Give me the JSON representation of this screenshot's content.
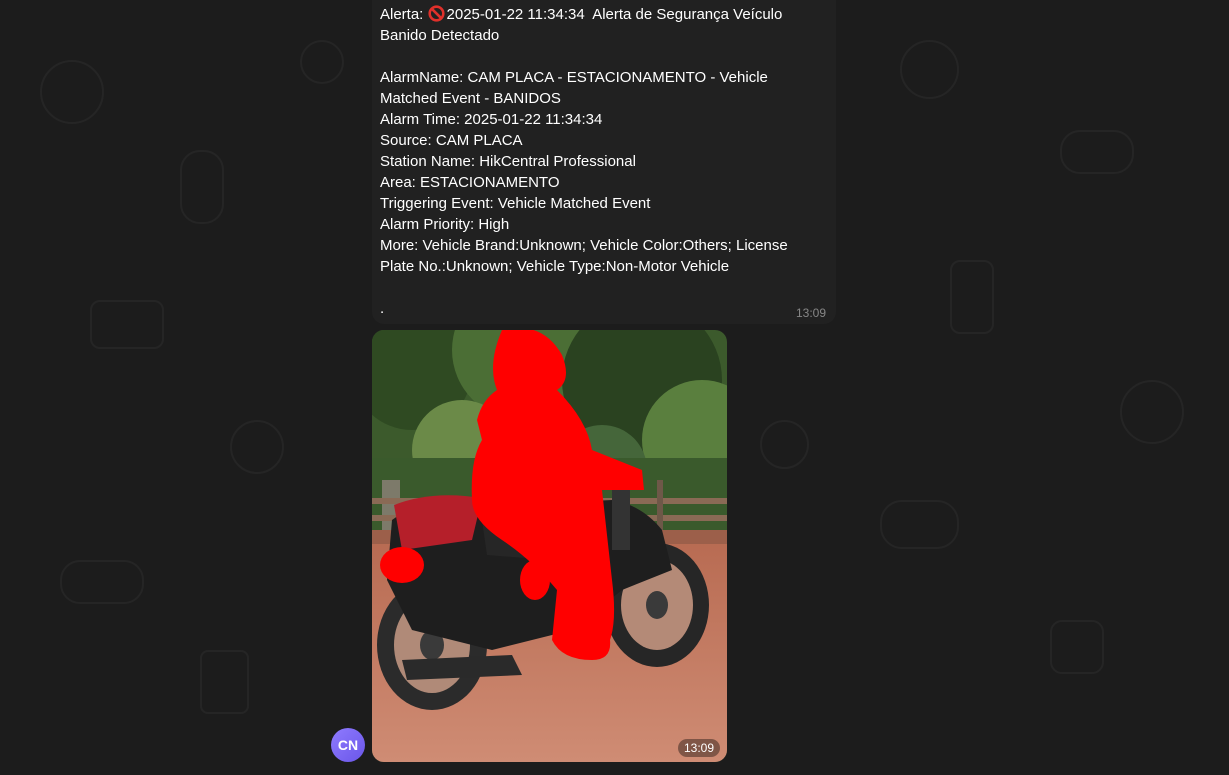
{
  "message": {
    "lines": [
      {
        "prefix": "Alerta: ",
        "icon": "no-entry-emoji",
        "text": "2025-01-22 11:34:34  Alerta de Segurança Veículo"
      },
      {
        "text": "Banido Detectado"
      },
      {
        "text": ""
      },
      {
        "text": "AlarmName: CAM PLACA - ESTACIONAMENTO - Vehicle"
      },
      {
        "text": "Matched Event - BANIDOS"
      },
      {
        "text": "Alarm Time: 2025-01-22 11:34:34"
      },
      {
        "text": "Source: CAM PLACA"
      },
      {
        "text": "Station Name: HikCentral Professional"
      },
      {
        "text": "Area: ESTACIONAMENTO"
      },
      {
        "text": "Triggering Event: Vehicle Matched Event"
      },
      {
        "text": "Alarm Priority: High"
      },
      {
        "text": "More: Vehicle Brand:Unknown; Vehicle Color:Others; License"
      },
      {
        "text": "Plate No.:Unknown; Vehicle Type:Non-Motor Vehicle"
      },
      {
        "text": ""
      },
      {
        "text": "."
      }
    ],
    "time": "13:09"
  },
  "photo": {
    "time": "13:09",
    "subject": "motorcycle-with-redacted-rider"
  },
  "sender": {
    "initials": "CN",
    "avatar_color": "#7a66f0"
  },
  "colors": {
    "background": "#1c1c1c",
    "bubble": "#212121",
    "redaction": "#ff0000"
  }
}
